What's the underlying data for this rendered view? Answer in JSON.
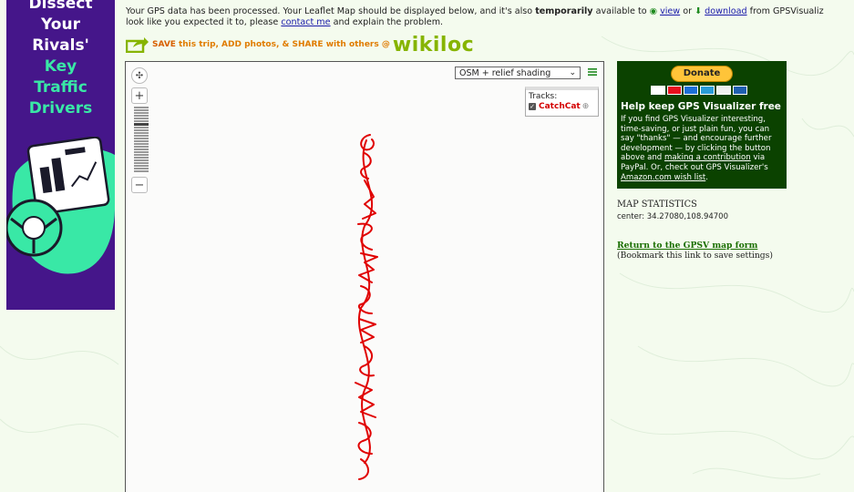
{
  "ad": {
    "lines_white_1": [
      "Dissect",
      "Your",
      "Rivals'"
    ],
    "lines_green": [
      "Key",
      "Traffic",
      "Drivers"
    ]
  },
  "intro": {
    "line1_a": "Your GPS data has been processed. Your Leaflet Map should be displayed below, and it's also ",
    "line1_bold": "temporarily",
    "line1_b": " available to ",
    "view_link": "view",
    "or": " or ",
    "download_link": "download",
    "line1_c": " from GPSVisualiz",
    "line2_a": "look like you expected it to, please ",
    "contact_link": "contact me",
    "line2_b": " and explain the problem."
  },
  "wikiloc": {
    "save": "SAVE",
    "mid": "this trip, ADD photos, & SHARE with others @",
    "logo": "wikiloc"
  },
  "map": {
    "layer_selected": "OSM + relief shading",
    "tracks_label": "Tracks:",
    "track_name": "CatchCat",
    "track_color": "#e00000"
  },
  "donate": {
    "button": "Donate",
    "title": "Help keep GPS Visualizer free",
    "text1": "If you find GPS Visualizer interesting, time-saving, or just plain fun, you can say \"thanks\" — and encourage further development — by clicking the button above and ",
    "contribution_link": "making a contribution",
    "text2": " via PayPal. Or, check out GPS Visualizer's ",
    "wishlist_link": "Amazon.com wish list",
    "text3": "."
  },
  "stats": {
    "heading": "MAP STATISTICS",
    "center": "center: 34.27080,108.94700"
  },
  "return": {
    "link": "Return to the GPSV map form",
    "note": "(Bookmark this link to save settings)"
  }
}
